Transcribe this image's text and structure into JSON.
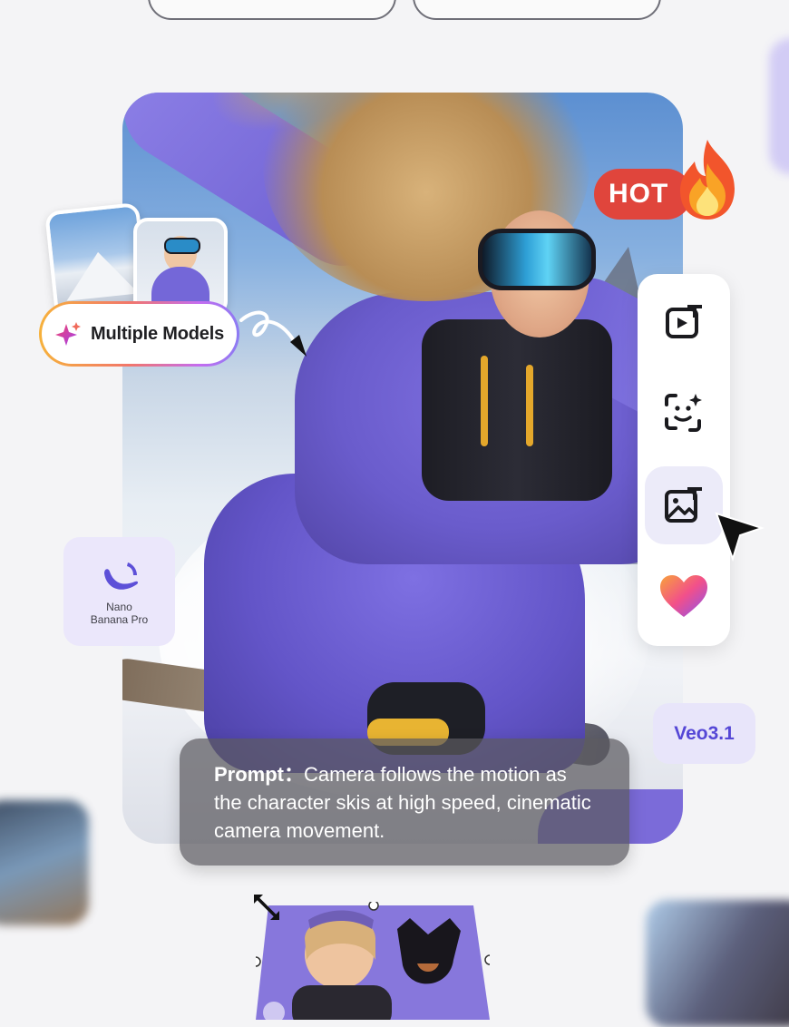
{
  "badges": {
    "hot": "HOT",
    "multiple_models": "Multiple Models",
    "veo": "Veo3.1"
  },
  "nano_banana": {
    "line1": "Nano",
    "line2": "Banana Pro"
  },
  "prompt": {
    "label": "Prompt：",
    "text": "Camera follows the motion as the character skis at high speed, cinematic camera movement."
  },
  "toolbar": {
    "items": [
      {
        "icon": "video-text-icon",
        "active": false
      },
      {
        "icon": "face-sparkle-icon",
        "active": false
      },
      {
        "icon": "image-text-icon",
        "active": true
      },
      {
        "icon": "heart-icon",
        "active": false
      }
    ]
  },
  "colors": {
    "accent_purple": "#6a5ccc",
    "hot_red": "#e0453c",
    "veo_text": "#5547d6",
    "toolbar_active": "#ecebf9"
  }
}
